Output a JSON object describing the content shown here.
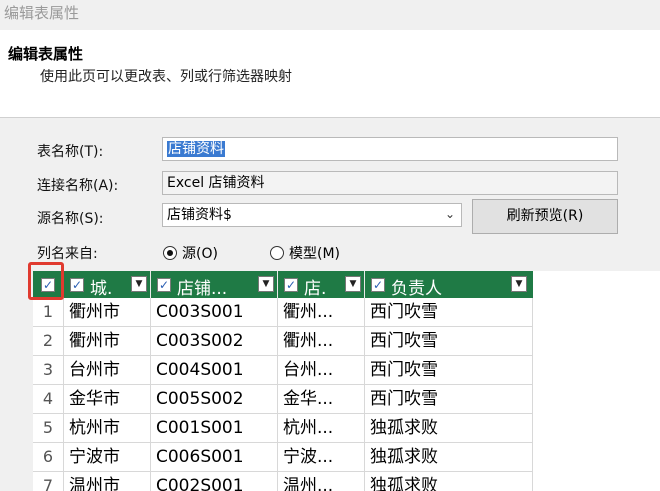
{
  "window": {
    "title": "编辑表属性"
  },
  "header": {
    "title": "编辑表属性",
    "subtitle": "使用此页可以更改表、列或行筛选器映射"
  },
  "form": {
    "table_name_label": "表名称(T):",
    "table_name_value": "店铺资料",
    "connection_label": "连接名称(A):",
    "connection_value": "Excel 店铺资料",
    "source_label": "源名称(S):",
    "source_value": "店铺资料$",
    "refresh_button": "刷新预览(R)",
    "column_from_label": "列名来自:",
    "radio_source": "源(O)",
    "radio_model": "模型(M)",
    "radio_selected": "source"
  },
  "grid": {
    "headers": [
      "城.",
      "店铺...",
      "店.",
      "负责人"
    ],
    "rows": [
      {
        "n": "1",
        "c": [
          "衢州市",
          "C003S001",
          "衢州...",
          "西门吹雪"
        ]
      },
      {
        "n": "2",
        "c": [
          "衢州市",
          "C003S002",
          "衢州...",
          "西门吹雪"
        ]
      },
      {
        "n": "3",
        "c": [
          "台州市",
          "C004S001",
          "台州...",
          "西门吹雪"
        ]
      },
      {
        "n": "4",
        "c": [
          "金华市",
          "C005S002",
          "金华...",
          "西门吹雪"
        ]
      },
      {
        "n": "5",
        "c": [
          "杭州市",
          "C001S001",
          "杭州...",
          "独孤求败"
        ]
      },
      {
        "n": "6",
        "c": [
          "宁波市",
          "C006S001",
          "宁波...",
          "独孤求败"
        ]
      },
      {
        "n": "7",
        "c": [
          "温州市",
          "C002S001",
          "温州...",
          "独孤求败"
        ]
      }
    ]
  },
  "colors": {
    "header_green": "#1f7a45",
    "highlight_red": "#e03a2f",
    "selection_blue": "#3a7ad1"
  }
}
